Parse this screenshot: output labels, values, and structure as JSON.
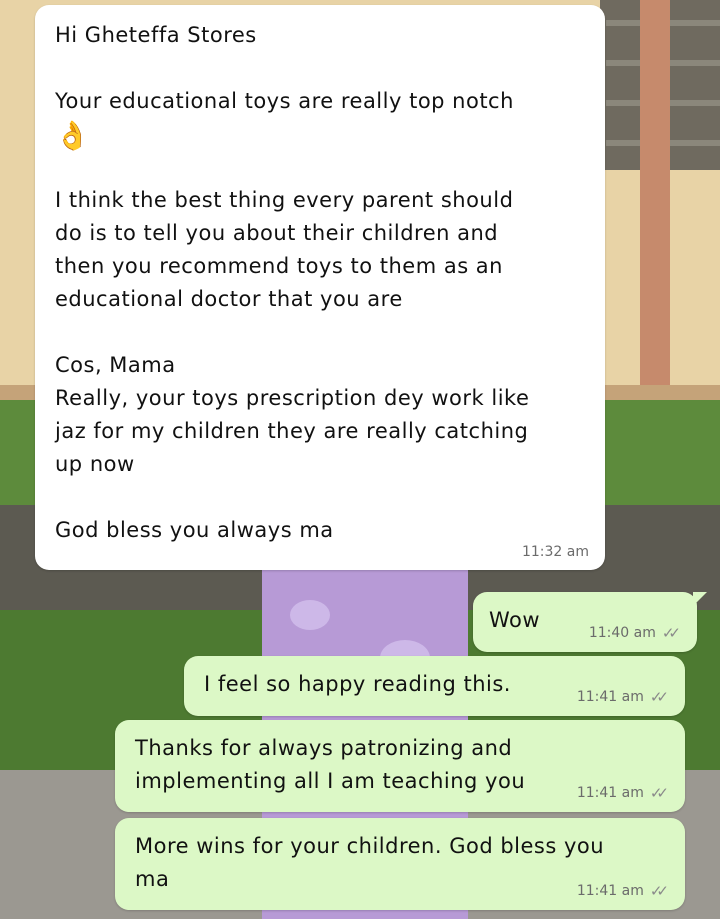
{
  "messages": [
    {
      "direction": "incoming",
      "paragraphs": [
        "Hi Gheteffa Stores",
        "Your educational toys are really top notch",
        "👌",
        "I think the best thing every parent should\ndo is to tell you about their children and\nthen you recommend toys to them as an\neducational doctor that you are",
        "Cos, Mama\nReally, your toys prescription dey work like\njaz for my children they are really catching\nup now",
        "God bless you always ma"
      ],
      "time": "11:32 am"
    },
    {
      "direction": "outgoing",
      "text": "Wow",
      "time": "11:40 am",
      "status": "read"
    },
    {
      "direction": "outgoing",
      "text": "I feel so happy reading this.",
      "time": "11:41 am",
      "status": "read"
    },
    {
      "direction": "outgoing",
      "text": "Thanks for always patronizing and\nimplementing all I am teaching you",
      "time": "11:41 am",
      "status": "read"
    },
    {
      "direction": "outgoing",
      "text": "More wins for your children. God bless you\nma",
      "time": "11:41 am",
      "status": "read"
    }
  ],
  "icons": {
    "read_receipt": "double-check-icon"
  },
  "colors": {
    "incoming_bubble": "#ffffff",
    "outgoing_bubble": "#dcf8c6",
    "timestamp": "#6b6b6b"
  }
}
